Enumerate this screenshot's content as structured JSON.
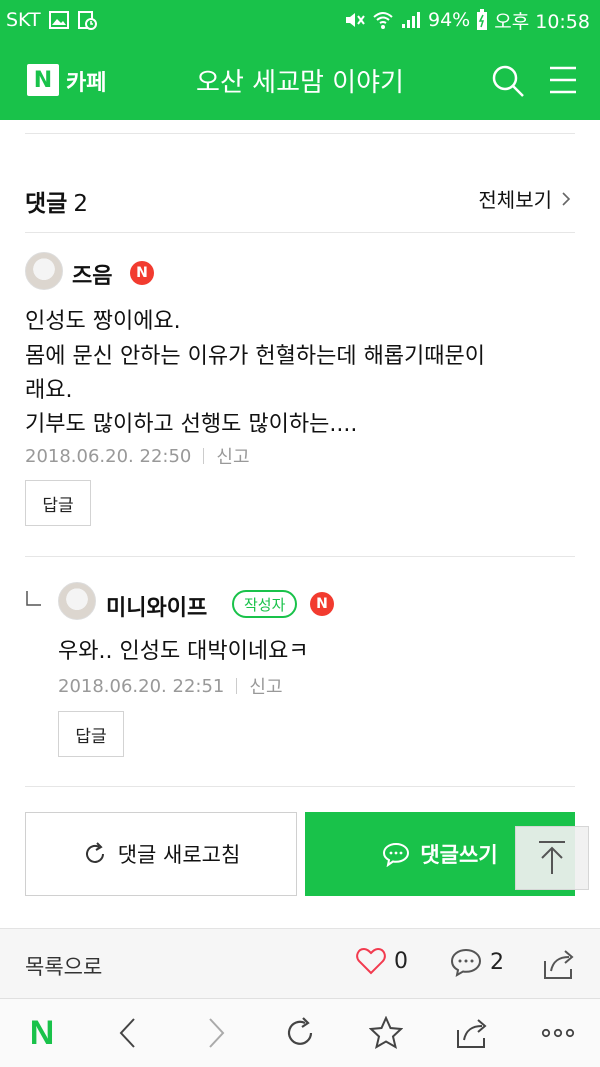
{
  "status_bar": {
    "carrier": "SKT",
    "battery": "94%",
    "time": "오후 10:58"
  },
  "header": {
    "logo_letter": "N",
    "logo_text": "카페",
    "cafe_name": "오산 세교맘 이야기"
  },
  "comments_section": {
    "title": "댓글",
    "count": "2",
    "view_all": "전체보기"
  },
  "comments": [
    {
      "author": "즈음",
      "n_badge": "N",
      "lines": [
        "인성도 짱이에요.",
        "몸에 문신 안하는 이유가 헌혈하는데 해롭기때문이",
        "래요.",
        "기부도 많이하고 선행도 많이하는...."
      ],
      "date": "2018.06.20. 22:50",
      "report": "신고",
      "reply": "답글"
    },
    {
      "author": "미니와이프",
      "writer_badge": "작성자",
      "n_badge": "N",
      "lines": [
        "우와.. 인성도 대박이네요ㅋ"
      ],
      "date": "2018.06.20. 22:51",
      "report": "신고",
      "reply": "답글"
    }
  ],
  "actions": {
    "refresh": "댓글 새로고침",
    "write": "댓글쓰기"
  },
  "post_bar": {
    "list": "목록으로",
    "likes": "0",
    "comments": "2"
  },
  "browser_nav": {
    "home_letter": "N"
  },
  "colors": {
    "brand_green": "#19c24a",
    "badge_red": "#f23b2f",
    "muted_text": "#999999"
  }
}
